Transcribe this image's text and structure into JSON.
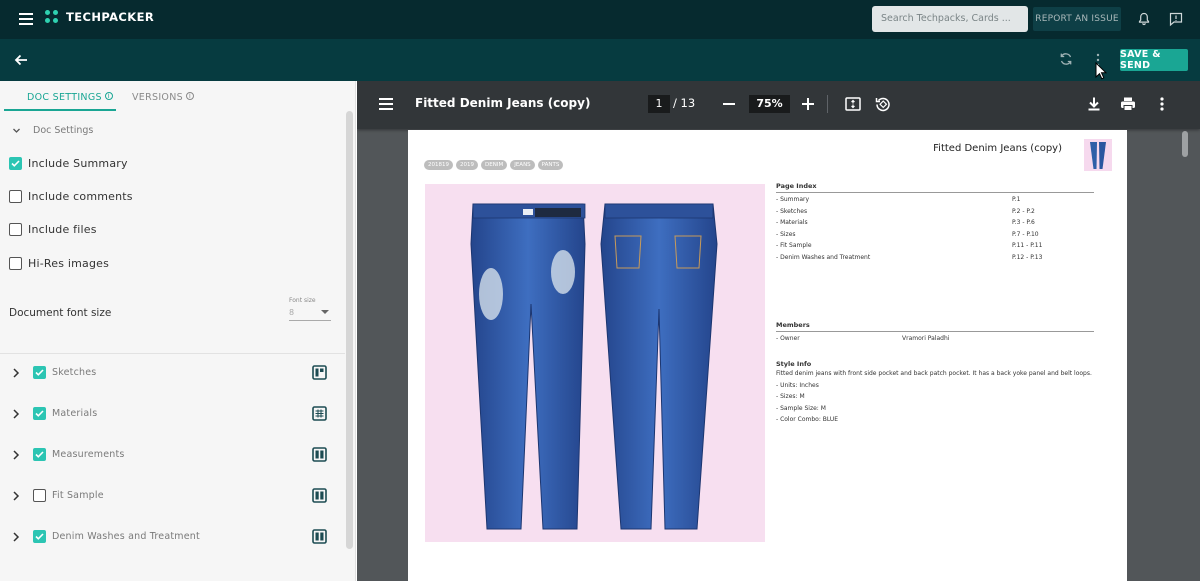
{
  "app": {
    "logo_text": "TECHPACKER",
    "search_placeholder": "Search Techpacks, Cards ...",
    "report_issue_label": "REPORT AN ISSUE",
    "save_send_label": "SAVE & SEND",
    "accent_color": "#1aa694",
    "header_color": "#062a2f"
  },
  "left_panel": {
    "tabs": [
      {
        "label": "DOC SETTINGS",
        "active": true
      },
      {
        "label": "VERSIONS",
        "active": false
      }
    ],
    "doc_settings_heading": "Doc Settings",
    "options": [
      {
        "label": "Include Summary",
        "checked": true
      },
      {
        "label": "Include comments",
        "checked": false
      },
      {
        "label": "Include files",
        "checked": false
      },
      {
        "label": "Hi-Res images",
        "checked": false
      }
    ],
    "font_size": {
      "label": "Document font size",
      "select_label": "Font size",
      "value": "8"
    },
    "sections": [
      {
        "label": "Sketches",
        "checked": true,
        "icon": "layout-split-icon"
      },
      {
        "label": "Materials",
        "checked": true,
        "icon": "layout-grid-icon"
      },
      {
        "label": "Measurements",
        "checked": true,
        "icon": "layout-columns-icon"
      },
      {
        "label": "Fit Sample",
        "checked": false,
        "icon": "layout-columns-icon"
      },
      {
        "label": "Denim Washes and Treatment",
        "checked": true,
        "icon": "layout-columns-icon"
      }
    ]
  },
  "viewer": {
    "title": "Fitted Denim Jeans (copy)",
    "current_page": "1",
    "page_count": "/ 13",
    "zoom": "75%"
  },
  "pdf_page": {
    "title": "Fitted Denim Jeans (copy)",
    "tags": [
      "201819",
      "2019",
      "DENIM",
      "JEANS",
      "PANTS"
    ],
    "index": {
      "heading": "Page Index",
      "rows": [
        {
          "name": "- Summary",
          "pages": "P.1"
        },
        {
          "name": "- Sketches",
          "pages": "P.2 - P.2"
        },
        {
          "name": "- Materials",
          "pages": "P.3 - P.6"
        },
        {
          "name": "- Sizes",
          "pages": "P.7 - P.10"
        },
        {
          "name": "- Fit Sample",
          "pages": "P.11 - P.11"
        },
        {
          "name": "- Denim Washes and Treatment",
          "pages": "P.12 - P.13"
        }
      ]
    },
    "members": {
      "heading": "Members",
      "rows": [
        {
          "role": "- Owner",
          "name": "Vramori Paladhi"
        }
      ]
    },
    "style_info": {
      "heading": "Style Info",
      "lines": [
        "Fitted denim jeans with front side pocket and back patch pocket. It has a back yoke panel and belt loops.",
        "- Units: Inches",
        "- Sizes: M",
        "- Sample Size: M",
        "- Color Combo: BLUE"
      ]
    }
  }
}
